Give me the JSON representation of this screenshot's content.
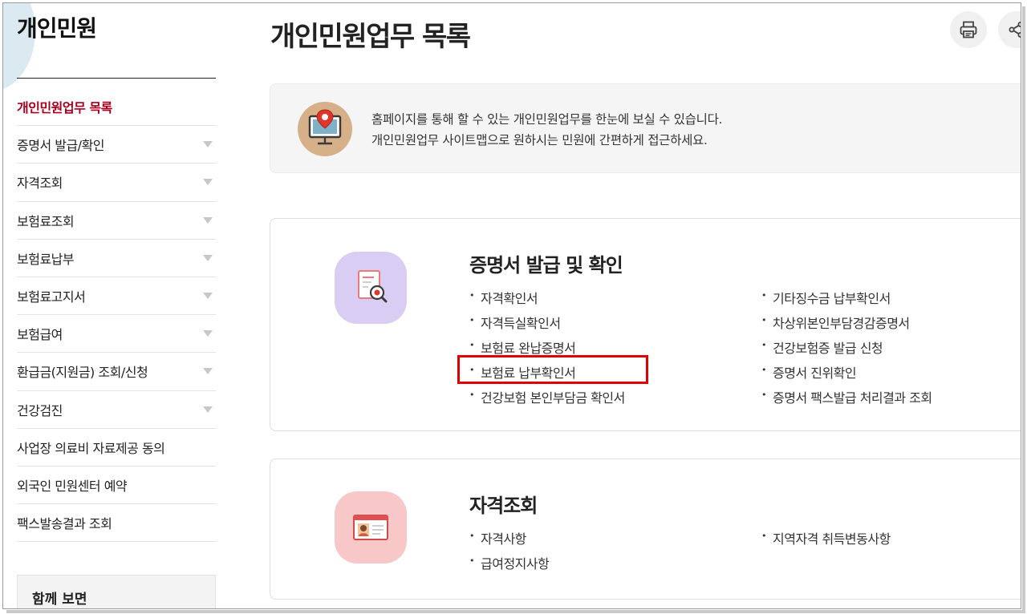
{
  "sidebar": {
    "title": "개인민원",
    "items": [
      {
        "label": "개인민원업무 목록",
        "active": true,
        "expandable": false
      },
      {
        "label": "증명서 발급/확인",
        "active": false,
        "expandable": true
      },
      {
        "label": "자격조회",
        "active": false,
        "expandable": true
      },
      {
        "label": "보험료조회",
        "active": false,
        "expandable": true
      },
      {
        "label": "보험료납부",
        "active": false,
        "expandable": true
      },
      {
        "label": "보험료고지서",
        "active": false,
        "expandable": true
      },
      {
        "label": "보험급여",
        "active": false,
        "expandable": true
      },
      {
        "label": "환급금(지원금) 조회/신청",
        "active": false,
        "expandable": true
      },
      {
        "label": "건강검진",
        "active": false,
        "expandable": true
      },
      {
        "label": "사업장 의료비 자료제공 동의",
        "active": false,
        "expandable": false
      },
      {
        "label": "외국인 민원센터 예약",
        "active": false,
        "expandable": false
      },
      {
        "label": "팩스발송결과 조회",
        "active": false,
        "expandable": false
      }
    ],
    "related_title": "함께 보면"
  },
  "main": {
    "title": "개인민원업무 목록",
    "toolbar": {
      "print_icon": "printer-icon",
      "share_icon": "share-icon"
    },
    "intro": {
      "line1": "홈페이지를 통해 할 수 있는 개인민원업무를 한눈에 보실 수 있습니다.",
      "line2": "개인민원업무 사이트맵으로 원하시는 민원에 간편하게 접근하세요."
    },
    "sections": [
      {
        "title": "증명서 발급 및 확인",
        "icon": "document-search-icon",
        "left_links": [
          "자격확인서",
          "자격득실확인서",
          "보험료 완납증명서",
          "보험료 납부확인서",
          "건강보험 본인부담금 확인서"
        ],
        "right_links": [
          "기타징수금 납부확인서",
          "차상위본인부담경감증명서",
          "건강보험증 발급 신청",
          "증명서 진위확인",
          "증명서 팩스발급 처리결과 조회"
        ],
        "highlighted": "보험료 납부확인서"
      },
      {
        "title": "자격조회",
        "icon": "id-card-icon",
        "left_links": [
          "자격사항",
          "급여정지사항"
        ],
        "right_links": [
          "지역자격 취득변동사항"
        ]
      }
    ]
  },
  "colors": {
    "active": "#a8001f",
    "highlight_border": "#e00000",
    "icon_bg_purple": "#d9cdf4",
    "icon_bg_pink": "#f8c7c7",
    "intro_icon_bg": "#d6b089"
  }
}
